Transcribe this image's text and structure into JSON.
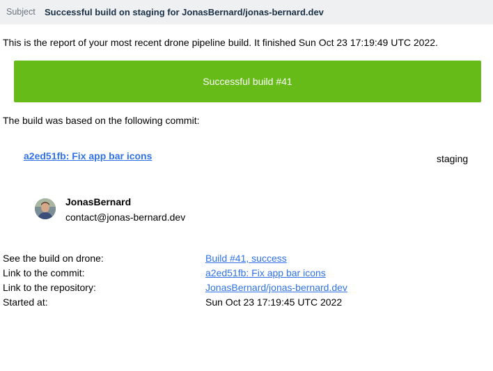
{
  "header": {
    "subject_label": "Subject",
    "subject": "Successful build on staging for JonasBernard/jonas-bernard.dev"
  },
  "body": {
    "intro": "This is the report of your most recent drone pipeline build. It finished Sun Oct 23 17:19:49 UTC 2022.",
    "banner": "Successful build #41",
    "based_on": "The build was based on the following commit:",
    "commit_link": "a2ed51fb: Fix app bar icons",
    "branch": "staging",
    "author": {
      "name": "JonasBernard",
      "email": "contact@jonas-bernard.dev"
    },
    "details": [
      {
        "label": "See the build on drone:",
        "value": "Build #41, success"
      },
      {
        "label": "Link to the commit:",
        "value": "a2ed51fb: Fix app bar icons"
      },
      {
        "label": "Link to the repository:",
        "value": "JonasBernard/jonas-bernard.dev"
      },
      {
        "label": "Started at:",
        "value": "Sun Oct 23 17:19:45 UTC 2022"
      }
    ]
  },
  "colors": {
    "success": "#66bb18",
    "link": "#2f72e6",
    "subject_bar": "#eef0f2"
  }
}
